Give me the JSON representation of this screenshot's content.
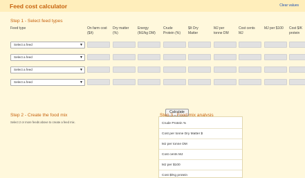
{
  "header": {
    "title": "Feed cost calculator",
    "clear_label": "Clear values"
  },
  "step1": {
    "heading": "Step 1 - Select feed types",
    "columns": [
      {
        "l1": "Feed type",
        "l2": ""
      },
      {
        "l1": "On farm cost",
        "l2": "($/t)"
      },
      {
        "l1": "Dry matter",
        "l2": "(%)"
      },
      {
        "l1": "Energy",
        "l2": "(MJ/kg DM)"
      },
      {
        "l1": "Crude",
        "l2": "Protein (%)"
      },
      {
        "l1": "$/t Dry",
        "l2": "Matter"
      },
      {
        "l1": "MJ per",
        "l2": "tonne DM"
      },
      {
        "l1": "Cost cents",
        "l2": "MJ"
      },
      {
        "l1": "MJ per $100",
        "l2": ""
      },
      {
        "l1": "Cost $/K",
        "l2": "protein"
      }
    ],
    "rows": [
      {
        "select": "Select a feed"
      },
      {
        "select": "Select a feed"
      },
      {
        "select": "Select a feed"
      },
      {
        "select": "Select a feed"
      }
    ],
    "calculate_label": "Calculate"
  },
  "step2": {
    "heading": "Step 2 - Create the food mix",
    "hint": "Select 2 or more feeds above to create a feed mix."
  },
  "step3": {
    "heading": "Step 3 - Food mix analysis",
    "rows": [
      "Crude Protein %",
      "Cost per tonne Dry Matter $",
      "MJ per tonne DM",
      "Cost cents MJ",
      "MJ per $100",
      "Cost $/Kg protein"
    ]
  }
}
